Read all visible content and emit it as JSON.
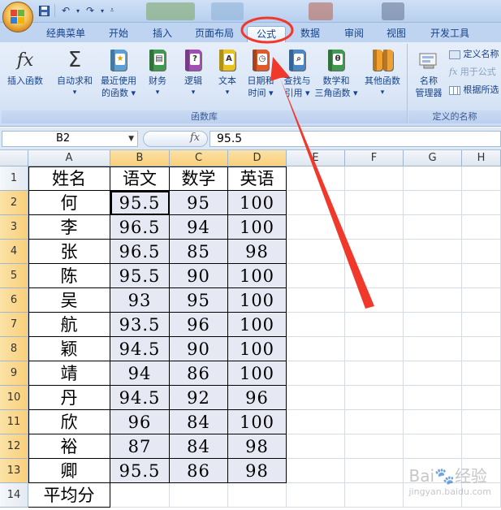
{
  "tabs": [
    {
      "label": "经典菜单",
      "active": false
    },
    {
      "label": "开始",
      "active": false
    },
    {
      "label": "插入",
      "active": false
    },
    {
      "label": "页面布局",
      "active": false
    },
    {
      "label": "公式",
      "active": true
    },
    {
      "label": "数据",
      "active": false
    },
    {
      "label": "审阅",
      "active": false
    },
    {
      "label": "视图",
      "active": false
    },
    {
      "label": "开发工具",
      "active": false
    }
  ],
  "ribbon": {
    "insert_function": "插入函数",
    "autosum": "自动求和",
    "recently_used_l1": "最近使用",
    "recently_used_l2": "的函数",
    "financial": "财务",
    "logical": "逻辑",
    "text": "文本",
    "datetime_l1": "日期和",
    "datetime_l2": "时间",
    "lookup_l1": "查找与",
    "lookup_l2": "引用",
    "math_l1": "数学和",
    "math_l2": "三角函数",
    "more_functions": "其他函数",
    "function_library_label": "函数库",
    "name_manager_l1": "名称",
    "name_manager_l2": "管理器",
    "define_name": "定义名称",
    "use_in_formula": "用于公式",
    "create_from_selection": "根据所选",
    "defined_names_label": "定义的名称"
  },
  "formula_bar": {
    "name_box": "B2",
    "fx_label": "fx",
    "formula": "95.5"
  },
  "columns": [
    "A",
    "B",
    "C",
    "D",
    "E",
    "F",
    "G",
    "H"
  ],
  "rows": [
    {
      "n": "1",
      "a": "姓名",
      "b": "语文",
      "c": "数学",
      "d": "英语"
    },
    {
      "n": "2",
      "a": "何",
      "b": "95.5",
      "c": "95",
      "d": "100"
    },
    {
      "n": "3",
      "a": "李",
      "b": "96.5",
      "c": "94",
      "d": "100"
    },
    {
      "n": "4",
      "a": "张",
      "b": "96.5",
      "c": "85",
      "d": "98"
    },
    {
      "n": "5",
      "a": "陈",
      "b": "95.5",
      "c": "90",
      "d": "100"
    },
    {
      "n": "6",
      "a": "吴",
      "b": "93",
      "c": "95",
      "d": "100"
    },
    {
      "n": "7",
      "a": "航",
      "b": "93.5",
      "c": "96",
      "d": "100"
    },
    {
      "n": "8",
      "a": "颖",
      "b": "94.5",
      "c": "90",
      "d": "100"
    },
    {
      "n": "9",
      "a": "靖",
      "b": "94",
      "c": "86",
      "d": "100"
    },
    {
      "n": "10",
      "a": "丹",
      "b": "94.5",
      "c": "92",
      "d": "96"
    },
    {
      "n": "11",
      "a": "欣",
      "b": "96",
      "c": "84",
      "d": "100"
    },
    {
      "n": "12",
      "a": "裕",
      "b": "87",
      "c": "84",
      "d": "98"
    },
    {
      "n": "13",
      "a": "卿",
      "b": "95.5",
      "c": "86",
      "d": "98"
    },
    {
      "n": "14",
      "a": "平均分",
      "b": "",
      "c": "",
      "d": ""
    }
  ],
  "colors": {
    "annotation_red": "#f0382b",
    "selection_header": "#f9cf7a",
    "selected_range": "#e6e9f4"
  },
  "watermark": {
    "brand": "Bai",
    "paw": "🐾",
    "suffix": "经验",
    "url": "jingyan.baidu.com"
  }
}
